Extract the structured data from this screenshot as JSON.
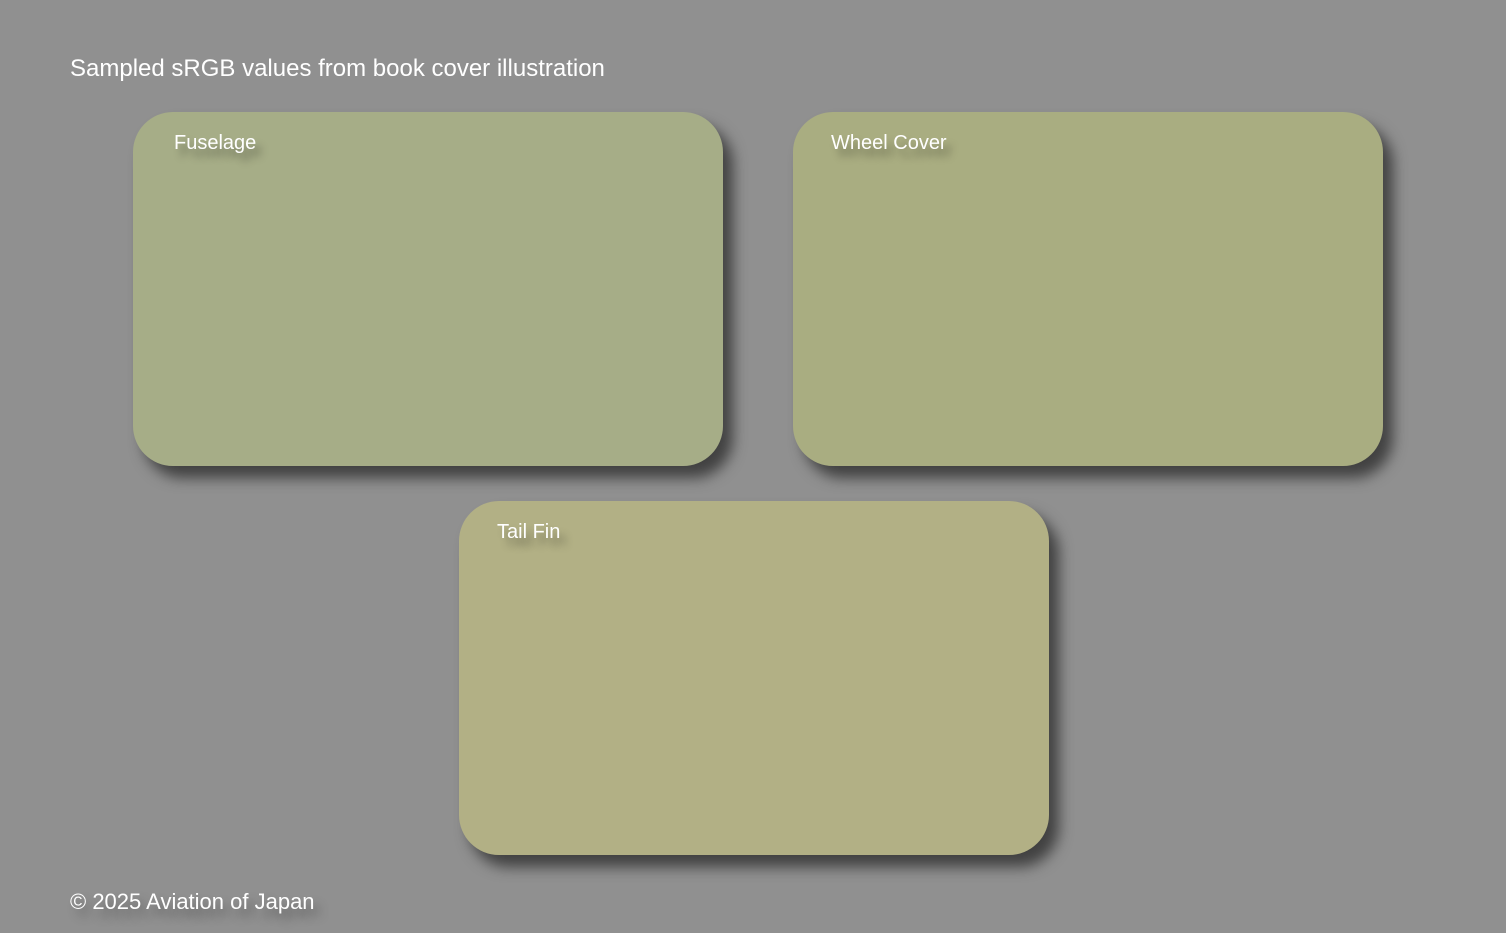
{
  "header": {
    "title": "Sampled sRGB values from book cover illustration"
  },
  "swatches": [
    {
      "label": "Fuselage",
      "color": "#a6ad87"
    },
    {
      "label": "Wheel Cover",
      "color": "#a9ad81"
    },
    {
      "label": "Tail Fin",
      "color": "#b2b085"
    }
  ],
  "footer": {
    "copyright": "© 2025 Aviation of Japan"
  },
  "colors": {
    "background": "#909090",
    "text": "#ffffff"
  }
}
